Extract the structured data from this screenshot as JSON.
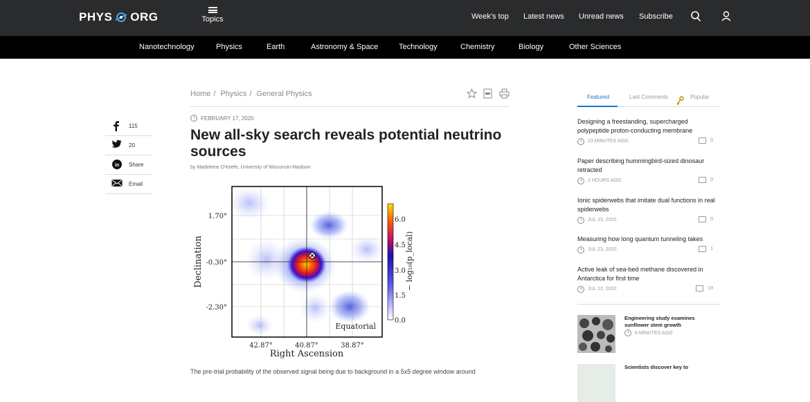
{
  "header": {
    "logo_left": "PHYS",
    "logo_right": "ORG",
    "topics_label": "Topics",
    "nav": [
      "Week's top",
      "Latest news",
      "Unread news",
      "Subscribe"
    ]
  },
  "categories": [
    "Nanotechnology",
    "Physics",
    "Earth",
    "Astronomy & Space",
    "Technology",
    "Chemistry",
    "Biology",
    "Other Sciences"
  ],
  "breadcrumb": [
    "Home",
    "Physics",
    "General Physics"
  ],
  "article": {
    "date": "FEBRUARY 17, 2020",
    "title": "New all-sky search reveals potential neutrino sources",
    "byline": "by Madeleine O'Keefe, University of Wisconsin-Madison",
    "body_start": "The pre-trial probability of the observed signal being due to background in a 5x5 degree window around"
  },
  "social": [
    {
      "icon": "facebook-icon",
      "label": "115"
    },
    {
      "icon": "twitter-icon",
      "label": "20"
    },
    {
      "icon": "linkedin-icon",
      "label": "Share"
    },
    {
      "icon": "email-icon",
      "label": "Email"
    }
  ],
  "figure": {
    "ylabel": "Declination",
    "xlabel": "Right Ascension",
    "yticks": [
      "1.70°",
      "-0.30°",
      "-2.30°"
    ],
    "xticks": [
      "42.87°",
      "40.87°",
      "38.87°"
    ],
    "cbar_ticks": [
      "6.0",
      "4.5",
      "3.0",
      "1.5",
      "0.0"
    ],
    "cbar_label": "− log₁₀(p_local)",
    "frame_label": "Equatorial"
  },
  "sidebar": {
    "tabs": [
      "Featured",
      "Last Comments",
      "Popular"
    ],
    "items": [
      {
        "title": "Designing a freestanding, supercharged polypeptide proton-conducting membrane",
        "time": "23 MINUTES AGO",
        "comments": "0"
      },
      {
        "title": "Paper describing hummingbird-sized dinosaur retracted",
        "time": "2 HOURS AGO",
        "comments": "0"
      },
      {
        "title": "Ionic spiderwebs that imitate dual functions in real spiderwebs",
        "time": "JUL 23, 2020",
        "comments": "0"
      },
      {
        "title": "Measuring how long quantum tunneling takes",
        "time": "JUL 23, 2020",
        "comments": "1"
      },
      {
        "title": "Active leak of sea-bed methane discovered in Antarctica for first time",
        "time": "JUL 22, 2020",
        "comments": "19"
      }
    ],
    "thumb_items": [
      {
        "title": "Engineering study examines sunflower stem growth",
        "time": "8 MINUTES AGO"
      },
      {
        "title": "Scientists discover key to",
        "time": ""
      }
    ]
  },
  "colors": {
    "topbar": "#2a2b2d",
    "catbar": "#000000",
    "accent": "#1a73c9"
  }
}
